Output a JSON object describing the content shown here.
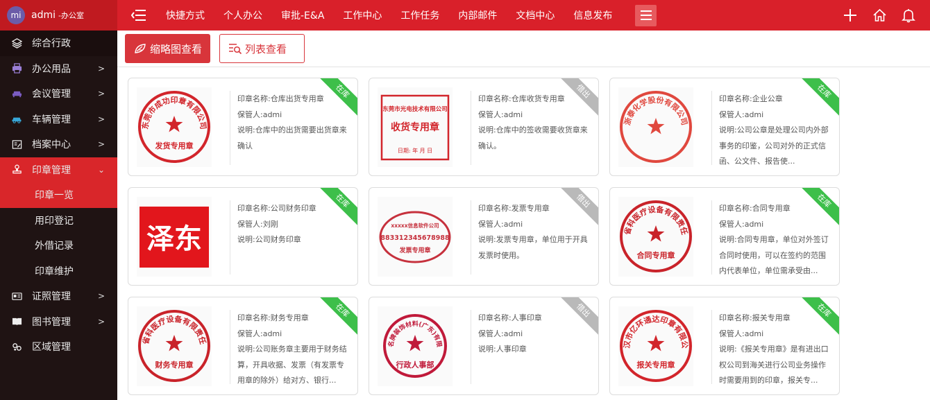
{
  "user": {
    "avatar": "mi",
    "name": "admi",
    "dept": "-办公室"
  },
  "sidebar": {
    "items": [
      {
        "label": "综合行政",
        "icon": "layers-icon"
      },
      {
        "label": "办公用品",
        "icon": "printer-icon"
      },
      {
        "label": "会议管理",
        "icon": "sofa-icon"
      },
      {
        "label": "车辆管理",
        "icon": "car-icon"
      },
      {
        "label": "档案中心",
        "icon": "archive-icon"
      },
      {
        "label": "印章管理",
        "icon": "stamp-icon"
      },
      {
        "label": "证照管理",
        "icon": "id-card-icon"
      },
      {
        "label": "图书管理",
        "icon": "book-icon"
      },
      {
        "label": "区域管理",
        "icon": "region-icon"
      }
    ],
    "subitems": [
      "印章一览",
      "用印登记",
      "外借记录",
      "印章维护"
    ]
  },
  "nav": {
    "items": [
      "快捷方式",
      "个人办公",
      "审批-E&A",
      "工作中心",
      "工作任务",
      "内部邮件",
      "文档中心",
      "信息发布"
    ]
  },
  "toolbar": {
    "thumb_label": "缩略图查看",
    "list_label": "列表查看"
  },
  "cards": [
    {
      "name": "印章名称:仓库出货专用章",
      "keeper": "保管人:admi",
      "desc": "说明:仓库中的出货需要出货章来确认",
      "status": "在库",
      "stamp": {
        "shape": "circle",
        "top": "东莞市成功印章有限公司",
        "bottom": "发货专用章",
        "color": "#d2252b"
      }
    },
    {
      "name": "印章名称:仓库收货专用章",
      "keeper": "保管人:admi",
      "desc": "说明:仓库中的签收需要收货章来确认。",
      "status": "借出",
      "stamp": {
        "shape": "rect",
        "top": "东莞市光电技术有限公司",
        "bottom": "收货专用章",
        "extra": "日期:    年   月   日",
        "color": "#d2252b"
      }
    },
    {
      "name": "印章名称:企业公章",
      "keeper": "保管人:admi",
      "desc": "说明:公司公章是处理公司内外部事务的印鉴，公司对外的正式信函、公文件、报告使...",
      "status": "在库",
      "stamp": {
        "shape": "circle",
        "top": "浙泰化学股份有限公司",
        "bottom": "",
        "color": "#e0483e"
      }
    },
    {
      "name": "印章名称:公司财务印章",
      "keeper": "保管人:刘刚",
      "desc": "说明:公司财务印章",
      "status": "在库",
      "stamp": {
        "shape": "square",
        "top": "泽东",
        "bottom": "",
        "color": "#e2161c"
      }
    },
    {
      "name": "印章名称:发票专用章",
      "keeper": "保管人:admi",
      "desc": "说明:发票专用章，单位用于开具发票时使用。",
      "status": "借出",
      "stamp": {
        "shape": "oval",
        "top": "xxxxx信息软件公司",
        "bottom": "发票专用章",
        "extra": "883312345678988",
        "color": "#c6313d"
      }
    },
    {
      "name": "印章名称:合同专用章",
      "keeper": "保管人:admi",
      "desc": "说明:合同专用章，单位对外签订合同时使用，可以在签约的范围内代表单位，单位需承受由...",
      "status": "在库",
      "stamp": {
        "shape": "circle",
        "top": "贵州省科医疗设备有限责任公司",
        "bottom": "合同专用章",
        "color": "#c9232a"
      }
    },
    {
      "name": "印章名称:财务专用章",
      "keeper": "保管人:admi",
      "desc": "说明:公司账务章主要用于财务结算，开具收据、发票（有发票专用章的除外）给对方、银行...",
      "status": "在库",
      "stamp": {
        "shape": "circle",
        "top": "贵州省科医疗设备有限责任公司",
        "bottom": "财务专用章",
        "color": "#c9232a"
      }
    },
    {
      "name": "印章名称:人事印章",
      "keeper": "保管人:admi",
      "desc": "说明:人事印章",
      "status": "借出",
      "stamp": {
        "shape": "circle-small",
        "top": "世界名牌装饰材料(广东)有限公司",
        "bottom": "行政人事部",
        "color": "#c01a3a"
      }
    },
    {
      "name": "印章名称:报关专用章",
      "keeper": "保管人:admi",
      "desc": "说明:《报关专用章》是有进出口权公司到海关进行公司业务操作时需要用到的印章，报关专...",
      "status": "在库",
      "stamp": {
        "shape": "circle",
        "top": "武汉市亿环通达印章有限公司",
        "bottom": "报关专用章",
        "color": "#d2252b"
      }
    }
  ]
}
